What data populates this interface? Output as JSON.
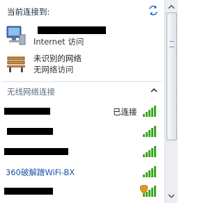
{
  "header": {
    "title": "当前连接到:",
    "refresh_icon": "refresh-icon"
  },
  "connected": [
    {
      "icon": "network-computer-icon",
      "name_redacted": true,
      "status": "Internet 访问"
    },
    {
      "icon": "park-bench-icon",
      "name": "未识别的网络",
      "status": "无网络访问"
    }
  ],
  "wireless_section": {
    "title": "无线网络连接",
    "collapse_icon": "chevron-up-icon"
  },
  "networks": [
    {
      "name_redacted": true,
      "status": "已连接",
      "signal_bars": 5,
      "secured": false
    },
    {
      "name_redacted": true,
      "status": "",
      "signal_bars": 5,
      "secured": false
    },
    {
      "name_redacted": true,
      "status": "",
      "signal_bars": 5,
      "secured": false
    },
    {
      "name": "360破解蹭WiFi-BX",
      "status": "",
      "signal_bars": 5,
      "secured": false
    },
    {
      "name_redacted": true,
      "status": "",
      "signal_bars": 5,
      "secured": true
    }
  ],
  "colors": {
    "signal_green": "#3aa71f",
    "link_blue": "#1c4fa8",
    "redaction": "#000000"
  }
}
